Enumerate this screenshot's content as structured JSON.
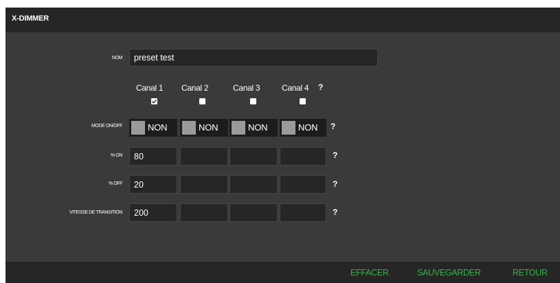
{
  "window": {
    "title": "X-DIMMER"
  },
  "form": {
    "nom": {
      "label": "NOM",
      "value": "preset test"
    },
    "channels": [
      {
        "label": "Canal 1",
        "checked": true
      },
      {
        "label": "Canal 2",
        "checked": false
      },
      {
        "label": "Canal 3",
        "checked": false
      },
      {
        "label": "Canal 4",
        "checked": false
      }
    ],
    "help_glyph": "?",
    "mode": {
      "label": "MODE ON/OFF",
      "values": [
        "NON",
        "NON",
        "NON",
        "NON"
      ]
    },
    "pct_on": {
      "label": "% ON",
      "values": [
        "80",
        "",
        "",
        ""
      ]
    },
    "pct_off": {
      "label": "% OFF",
      "values": [
        "20",
        "",
        "",
        ""
      ]
    },
    "vitesse": {
      "label": "VITESSE DE TRANSITION",
      "values": [
        "200",
        "",
        "",
        ""
      ]
    }
  },
  "footer": {
    "effacer": "EFFACER",
    "sauvegarder": "SAUVEGARDER",
    "retour": "RETOUR"
  },
  "colors": {
    "accent_green": "#33b349",
    "panel": "#3a3a3a",
    "bar": "#262626"
  },
  "icons": {
    "checkbox_checked": "checkmark-icon",
    "help": "question-mark-icon"
  }
}
